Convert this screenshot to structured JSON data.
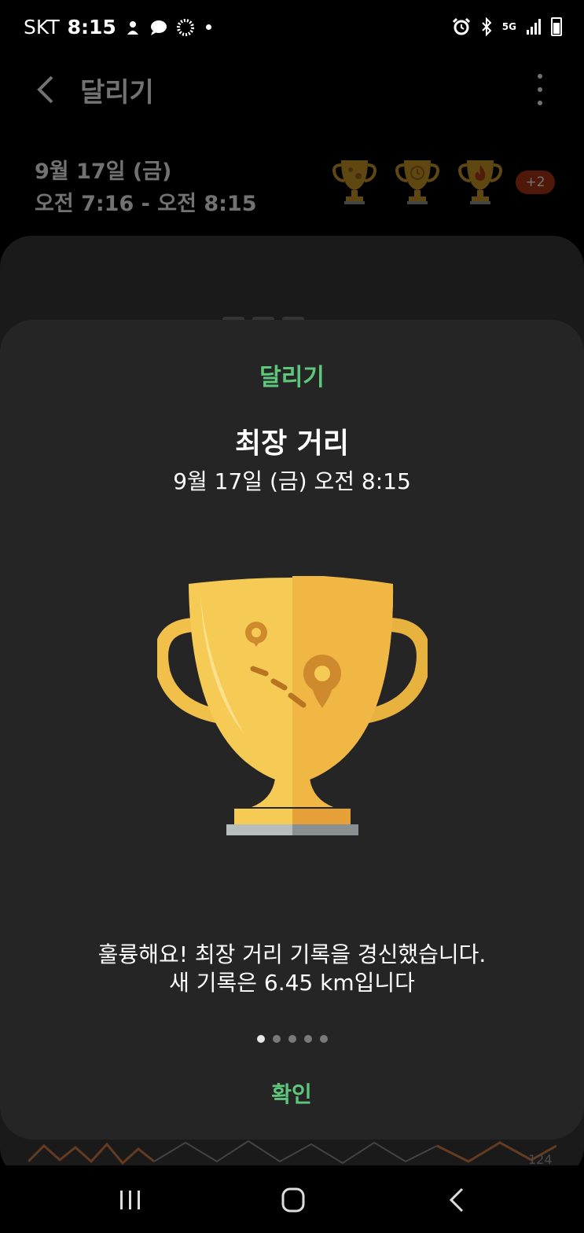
{
  "status_bar": {
    "carrier": "SKT",
    "time": "8:15",
    "network": "5G"
  },
  "header": {
    "title": "달리기"
  },
  "session": {
    "date": "9월 17일 (금)",
    "time_range": "오전 7:16 - 오전 8:15",
    "extra_trophies": "+2"
  },
  "graph": {
    "end_label": "124"
  },
  "sheet": {
    "category": "달리기",
    "title": "최장 거리",
    "datetime": "9월 17일 (금) 오전 8:15",
    "message_line1": "훌륭해요! 최장 거리 기록을 경신했습니다.",
    "message_line2": "새 기록은 6.45 km입니다",
    "confirm_label": "확인",
    "pages_total": 5,
    "page_current": 1
  },
  "colors": {
    "accent_green": "#5ec77b",
    "trophy_gold": "#f5c84f",
    "badge_red": "#b03716",
    "sheet_bg": "#252525"
  },
  "icons": {
    "back": "chevron-left-icon",
    "more": "more-vertical-icon",
    "trophy": "trophy-icon",
    "nav_recent": "recent-apps-icon",
    "nav_home": "home-icon",
    "nav_back": "nav-back-icon"
  }
}
